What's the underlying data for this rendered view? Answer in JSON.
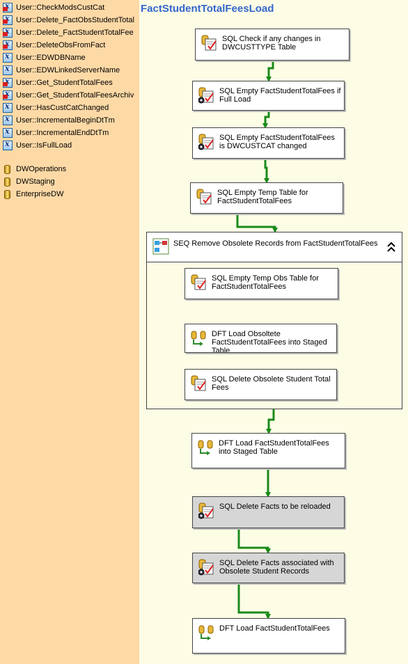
{
  "variables": [
    {
      "label": "User::CheckModsCustCat",
      "error": true
    },
    {
      "label": "User::Delete_FactObsStudentTotal",
      "error": true
    },
    {
      "label": "User::Delete_FactStudentTotalFee",
      "error": true
    },
    {
      "label": "User::DeleteObsFromFact",
      "error": true
    },
    {
      "label": "User::EDWDBName",
      "error": false
    },
    {
      "label": "User::EDWLinkedServerName",
      "error": false
    },
    {
      "label": "User::Get_StudentTotalFees",
      "error": true
    },
    {
      "label": "User::Get_StudentTotalFeesArchiv",
      "error": true
    },
    {
      "label": "User::HasCustCatChanged",
      "error": false
    },
    {
      "label": "User::IncrementalBeginDtTm",
      "error": false
    },
    {
      "label": "User::IncrementalEndDtTm",
      "error": false
    },
    {
      "label": "User::IsFullLoad",
      "error": false
    }
  ],
  "connections": [
    "DWOperations",
    "DWStaging",
    "EnterpriseDW"
  ],
  "package_title": "FactStudentTotalFeesLoad",
  "tasks": {
    "t1": {
      "label": "SQL Check if any changes in DWCUSTTYPE Table",
      "icon": "sql-task-icon"
    },
    "t2": {
      "label": "SQL Empty FactStudentTotalFees if Full Load",
      "icon": "sql-task-expression-icon"
    },
    "t3": {
      "label": "SQL Empty FactStudentTotalFees is DWCUSTCAT changed",
      "icon": "sql-task-expression-icon"
    },
    "t4": {
      "label": "SQL Empty Temp Table for FactStudentTotalFees",
      "icon": "sql-task-icon"
    },
    "seq": {
      "label": "SEQ Remove Obsolete Records from FactStudentTotalFees",
      "icon": "sequence-container-icon"
    },
    "s1": {
      "label": "SQL Empty Temp Obs Table for FactStudentTotalFees",
      "icon": "sql-task-icon"
    },
    "s2": {
      "label": "DFT Load Obsoltete FactStudentTotalFees into Staged Table",
      "icon": "data-flow-task-icon"
    },
    "s3": {
      "label": "SQL Delete Obsolete Student Total Fees",
      "icon": "sql-task-icon"
    },
    "t5": {
      "label": "DFT Load FactStudentTotalFees into Staged Table",
      "icon": "data-flow-task-icon"
    },
    "t6": {
      "label": "SQL Delete Facts to be reloaded",
      "icon": "sql-task-expression-icon"
    },
    "t7": {
      "label": "SQL Delete Facts associated with Obsolete Student Records",
      "icon": "sql-task-expression-icon"
    },
    "t8": {
      "label": "DFT Load FactStudentTotalFees",
      "icon": "data-flow-task-icon"
    }
  },
  "colors": {
    "pane": "#fdd9a6",
    "canvas": "#fdfde6",
    "title": "#3366cc",
    "precedence": "#1a8a1a",
    "disabled_task": "#d6d6d6"
  }
}
